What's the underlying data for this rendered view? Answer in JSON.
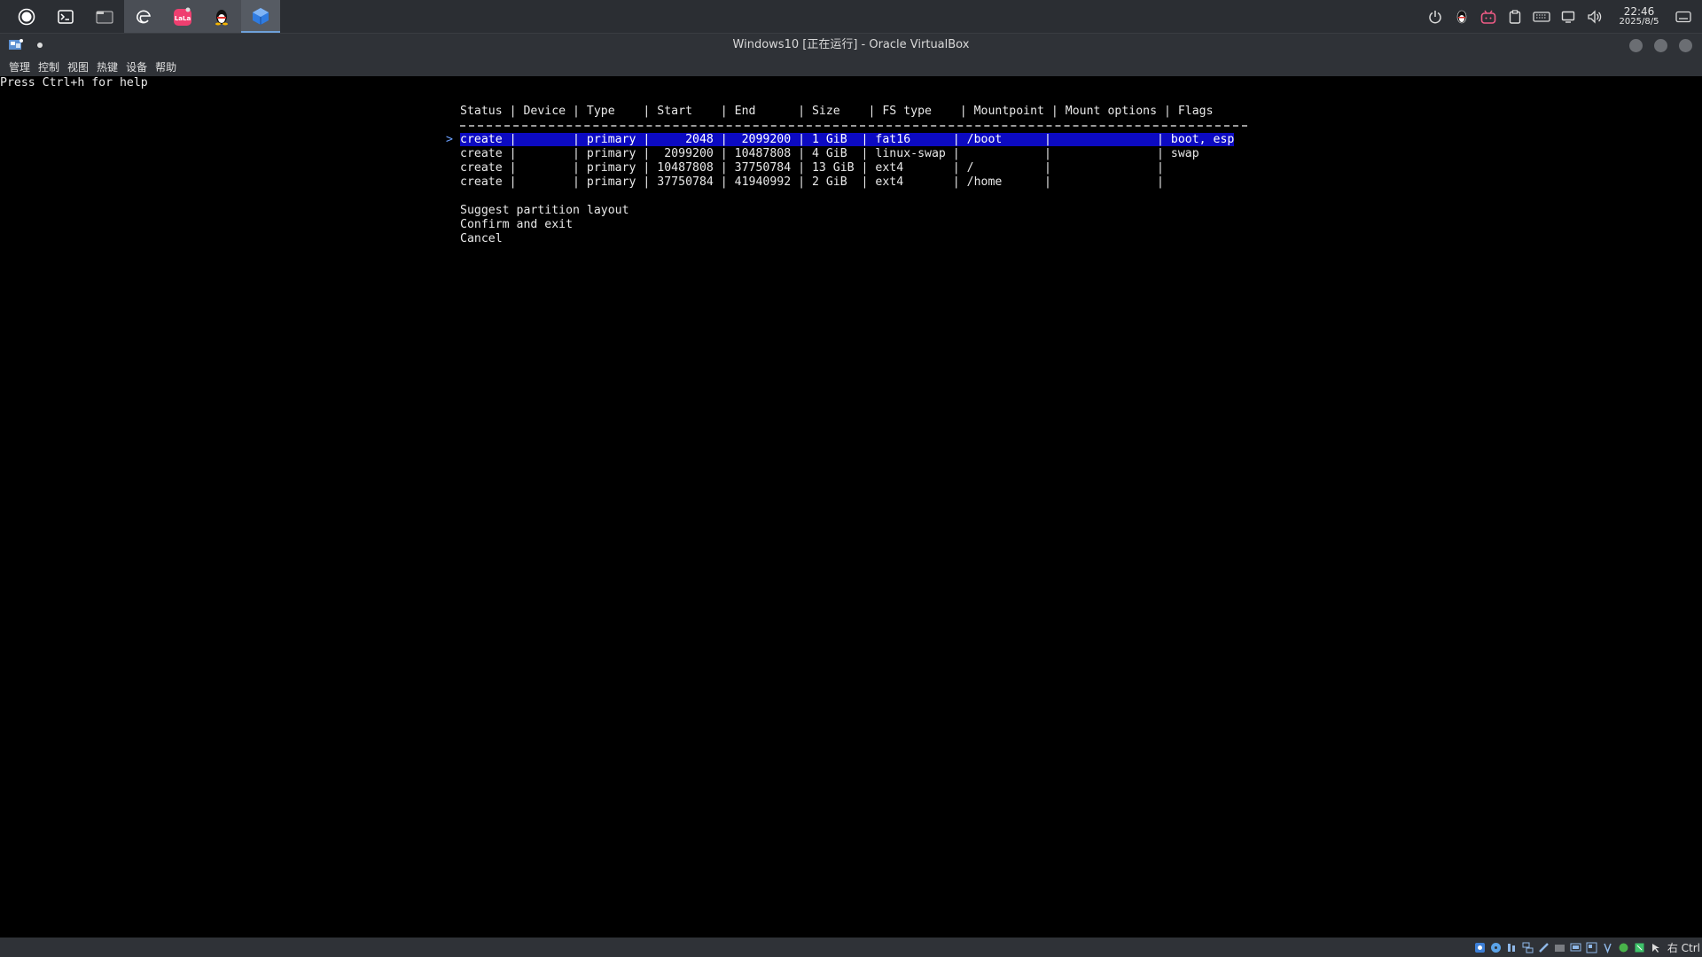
{
  "taskbar": {
    "apps": [
      {
        "icon": "record-circle-icon"
      },
      {
        "icon": "terminal-icon"
      },
      {
        "icon": "file-manager-icon"
      },
      {
        "icon": "edge-browser-icon"
      },
      {
        "icon": "lala-app-icon"
      },
      {
        "icon": "qq-penguin-icon"
      },
      {
        "icon": "virtualbox-icon"
      }
    ],
    "clock": {
      "time": "22:46",
      "date": "2025/8/5"
    }
  },
  "window": {
    "title": "Windows10 [正在运行] - Oracle VirtualBox"
  },
  "menu": {
    "items": [
      "管理",
      "控制",
      "视图",
      "热键",
      "设备",
      "帮助"
    ]
  },
  "terminal": {
    "help": "Press Ctrl+h for help",
    "header": "Status | Device | Type    | Start    | End      | Size    | FS type    | Mountpoint | Mount options | Flags",
    "rows": [
      "create |        | primary |     2048 |  2099200 | 1 GiB  | fat16      | /boot      |               | boot, esp",
      "create |        | primary |  2099200 | 10487808 | 4 GiB  | linux-swap |            |               | swap",
      "create |        | primary | 10487808 | 37750784 | 13 GiB | ext4       | /          |               |",
      "create |        | primary | 37750784 | 41940992 | 2 GiB  | ext4       | /home      |               |"
    ],
    "pointer": ">",
    "options": [
      "Suggest partition layout",
      "Confirm and exit",
      "Cancel"
    ]
  },
  "statusbar": {
    "host_key": "右 Ctrl"
  },
  "colors": {
    "selection": "#0c0ac2",
    "pointer": "#6aa0ff"
  }
}
